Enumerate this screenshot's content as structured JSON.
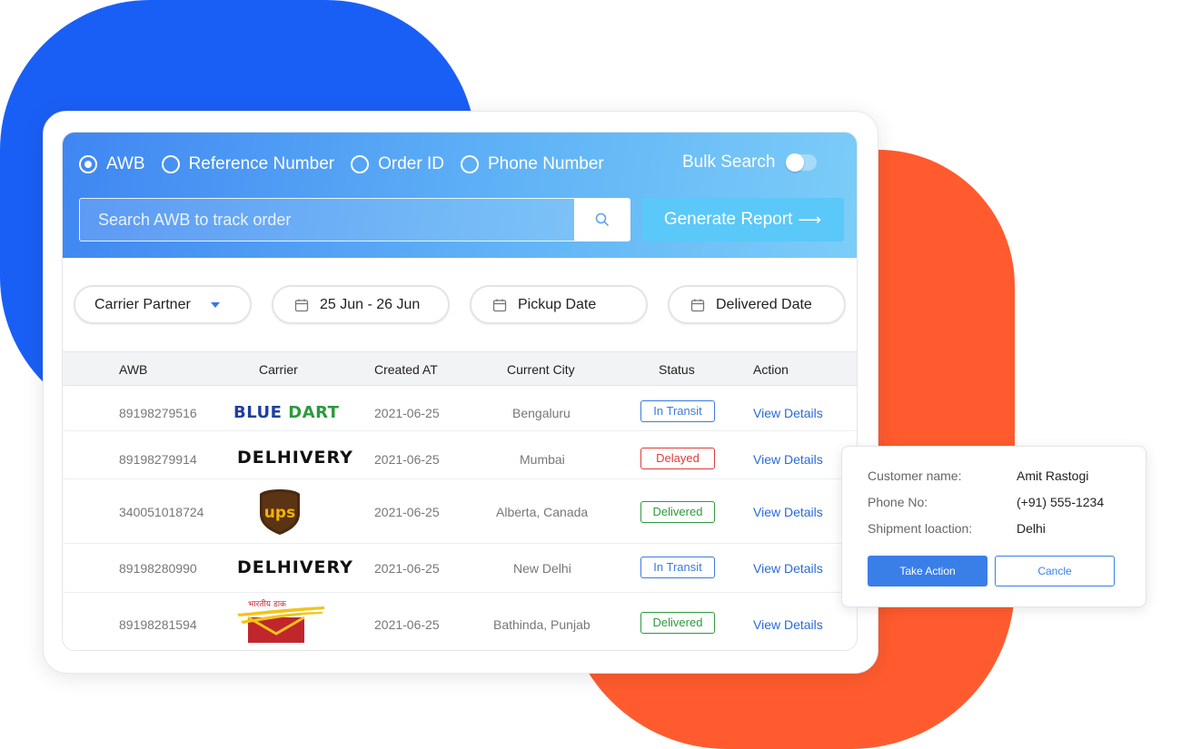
{
  "colors": {
    "accent_blue": "#1a5ff5",
    "accent_orange": "#ff5b2e",
    "link": "#2a6ad8",
    "status_in_transit": "#3a7be0",
    "status_delayed": "#e03b3b",
    "status_delivered": "#2e9a3e"
  },
  "search_types": [
    {
      "label": "AWB",
      "selected": true
    },
    {
      "label": "Reference Number",
      "selected": false
    },
    {
      "label": "Order ID",
      "selected": false
    },
    {
      "label": "Phone Number",
      "selected": false
    }
  ],
  "bulk_search": {
    "label": "Bulk Search",
    "enabled": false
  },
  "search": {
    "placeholder": "Search AWB to track order",
    "value": "",
    "icon": "search-icon"
  },
  "generate_report": {
    "label": "Generate Report",
    "icon": "arrow-right-icon"
  },
  "filters": {
    "carrier_partner": {
      "label": "Carrier Partner",
      "icon": "chevron-down-icon"
    },
    "date_range": {
      "label": "25 Jun - 26 Jun",
      "icon": "calendar-icon"
    },
    "pickup_date": {
      "label": "Pickup Date",
      "icon": "calendar-icon"
    },
    "delivered_date": {
      "label": "Delivered Date",
      "icon": "calendar-icon"
    }
  },
  "table": {
    "columns": [
      "AWB",
      "Carrier",
      "Created AT",
      "Current City",
      "Status",
      "Action"
    ],
    "rows": [
      {
        "awb": "89198279516",
        "carrier": "BLUE DART",
        "carrier_logo": "bluedart-logo",
        "created": "2021-06-25",
        "city": "Bengaluru",
        "status": "In Transit",
        "status_kind": "in_transit",
        "action": "View Details"
      },
      {
        "awb": "89198279914",
        "carrier": "DELHIVERY",
        "carrier_logo": "delhivery-logo",
        "created": "2021-06-25",
        "city": "Mumbai",
        "status": "Delayed",
        "status_kind": "delayed",
        "action": "View Details"
      },
      {
        "awb": "340051018724",
        "carrier": "UPS",
        "carrier_logo": "ups-logo",
        "created": "2021-06-25",
        "city": "Alberta, Canada",
        "status": "Delivered",
        "status_kind": "delivered",
        "action": "View Details"
      },
      {
        "awb": "89198280990",
        "carrier": "DELHIVERY",
        "carrier_logo": "delhivery-logo",
        "created": "2021-06-25",
        "city": "New Delhi",
        "status": "In Transit",
        "status_kind": "in_transit",
        "action": "View Details"
      },
      {
        "awb": "89198281594",
        "carrier": "भारतीय डाक",
        "carrier_logo": "india-post-logo",
        "created": "2021-06-25",
        "city": "Bathinda, Punjab",
        "status": "Delivered",
        "status_kind": "delivered",
        "action": "View Details"
      }
    ]
  },
  "popup": {
    "customer_name_label": "Customer name:",
    "customer_name": "Amit Rastogi",
    "phone_label": "Phone No:",
    "phone": "(+91) 555-1234",
    "location_label": "Shipment loaction:",
    "location": "Delhi",
    "take_action": "Take Action",
    "cancel": "Cancle"
  }
}
